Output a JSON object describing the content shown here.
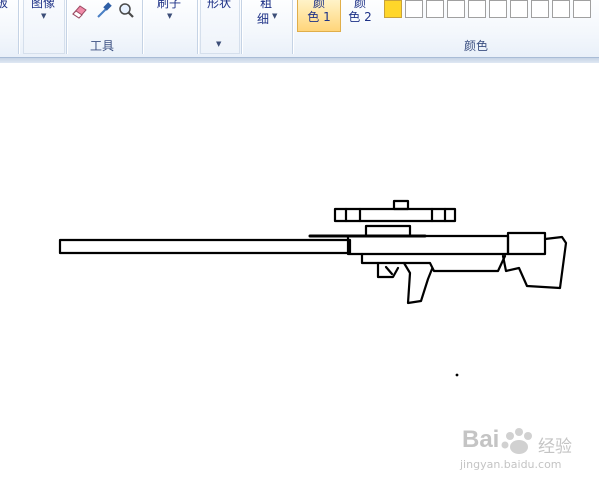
{
  "ribbon": {
    "clipboard_label": "板",
    "image_label": "图像",
    "tools_group_label": "工具",
    "brushes_label": "刷子",
    "shapes_label": "形状",
    "size_label_top": "粗",
    "size_label_bottom": "细",
    "color1_line1": "颜",
    "color1_line2": "色 1",
    "color2_line1": "颜",
    "color2_line2": "色 2",
    "colors_group_label": "颜色",
    "dropdown_arrow": "▼"
  },
  "colors": {
    "color1": "#ffd62a",
    "accent_selected": "#ffd970",
    "swatch_blank": "#ffffff"
  },
  "tools": [
    "eraser-icon",
    "color-picker-icon",
    "magnifier-icon"
  ],
  "watermark": {
    "brand": "Bai",
    "brand_cn": "经验",
    "url": "jingyan.baidu.com"
  }
}
